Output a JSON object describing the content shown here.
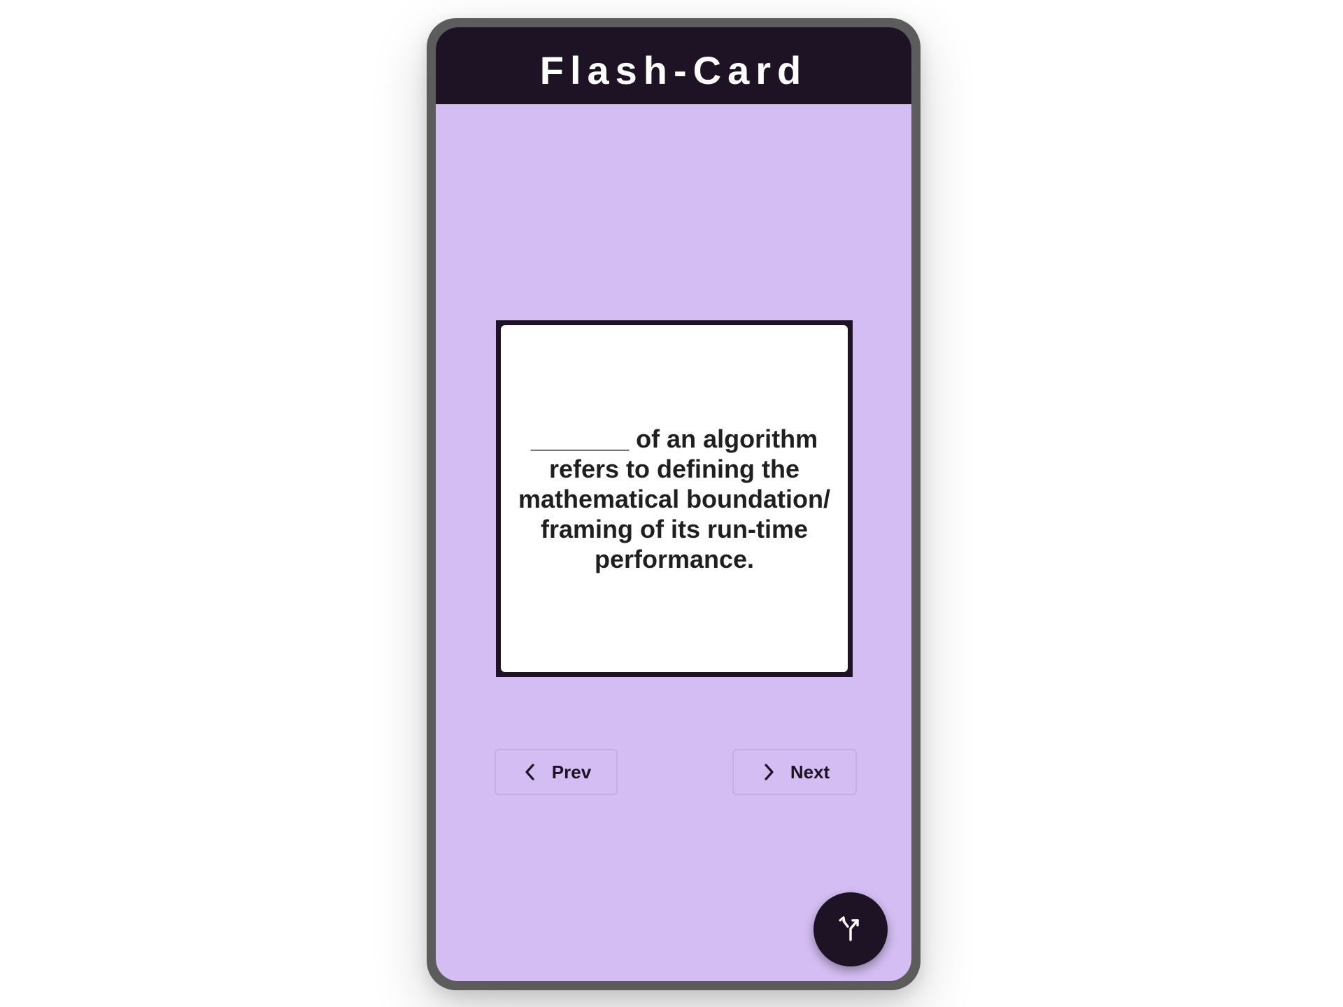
{
  "app": {
    "title": "Flash-Card"
  },
  "card": {
    "text": "_______ of an algorithm refers to defining the mathematical boundation/ framing of its run-time performance."
  },
  "navigation": {
    "prev_label": "Prev",
    "next_label": "Next",
    "prev_icon": "chevron-left-icon",
    "next_icon": "chevron-right-icon"
  },
  "fab": {
    "icon": "call-split-icon"
  },
  "colors": {
    "background": "#d4bdf2",
    "appbar": "#1d1325",
    "card": "#ffffff",
    "shell": "#5c5c5c",
    "button_border": "#c4aee2"
  }
}
